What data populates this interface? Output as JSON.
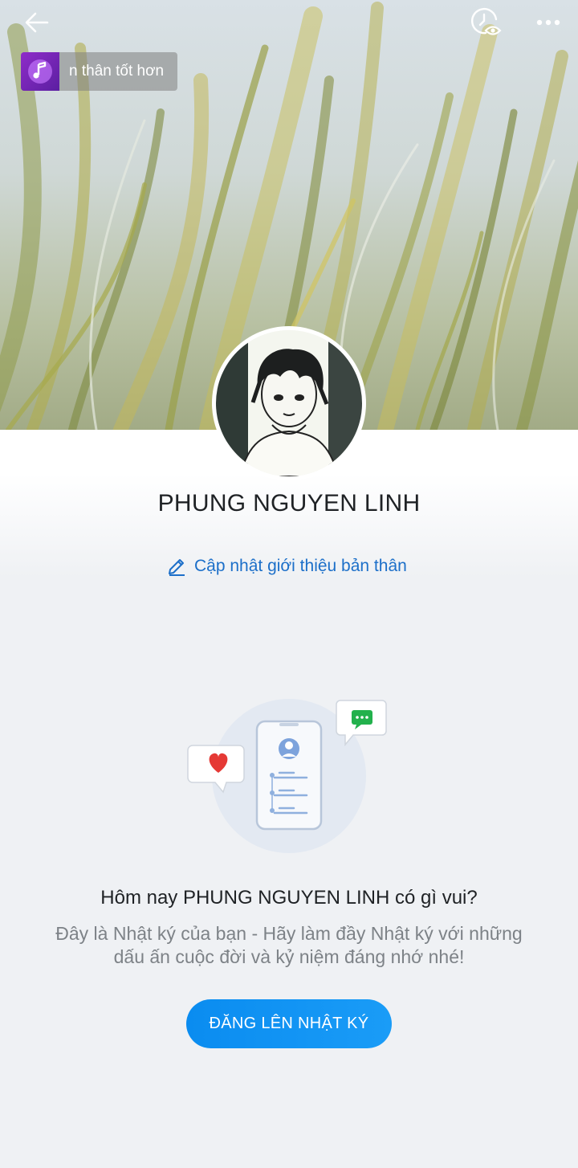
{
  "header": {
    "music_text": "n thân tốt hơn"
  },
  "profile": {
    "name": "PHUNG NGUYEN LINH",
    "update_intro_label": "Cập nhật giới thiệu bản thân"
  },
  "empty_state": {
    "headline": "Hôm nay PHUNG NGUYEN LINH có gì vui?",
    "description": "Đây là Nhật ký của bạn - Hãy làm đầy Nhật ký với những dấu ấn cuộc đời và kỷ niệm đáng nhớ nhé!",
    "post_button_label": "ĐĂNG LÊN NHẬT KÝ"
  },
  "colors": {
    "accent": "#0a8cf0",
    "link": "#1c6fc9",
    "heart": "#e53935",
    "chat_bubble": "#22b14c"
  },
  "icons": {
    "back": "arrow-left-icon",
    "history": "clock-eye-icon",
    "more": "more-horizontal-icon",
    "music": "music-note-icon",
    "edit": "pencil-icon"
  }
}
